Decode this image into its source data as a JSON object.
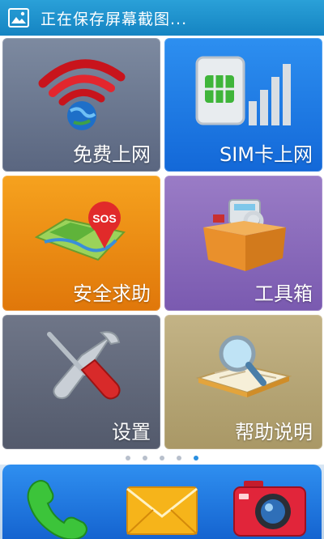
{
  "status_bar": {
    "icon": "screenshot-image-icon",
    "title": "正在保存屏幕截图..."
  },
  "tiles": [
    {
      "label": "免费上网",
      "icon": "wifi-globe-icon",
      "color": "#6b778f"
    },
    {
      "label": "SIM卡上网",
      "icon": "sim-card-signal-icon",
      "color": "#1f7ce6"
    },
    {
      "label": "安全求助",
      "icon": "sos-map-icon",
      "color": "#ee8c14"
    },
    {
      "label": "工具箱",
      "icon": "toolbox-icon",
      "color": "#8a6bbd"
    },
    {
      "label": "设置",
      "icon": "wrench-screwdriver-icon",
      "color": "#60677a"
    },
    {
      "label": "帮助说明",
      "icon": "book-magnifier-icon",
      "color": "#b6a576"
    }
  ],
  "page_indicator": {
    "count": 5,
    "active_index": 4
  },
  "dock": [
    {
      "icon": "phone-icon"
    },
    {
      "icon": "message-envelope-icon"
    },
    {
      "icon": "camera-icon"
    }
  ],
  "accent_color": "#1a8ad6"
}
